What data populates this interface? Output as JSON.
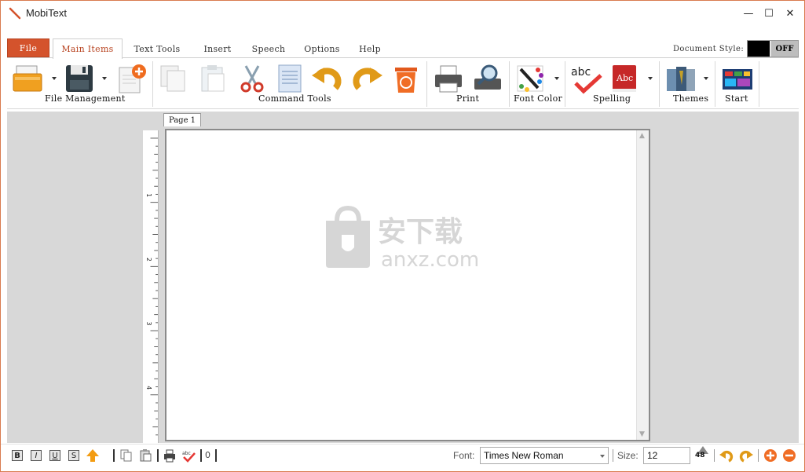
{
  "window": {
    "title": "MobiText",
    "minimize": "—",
    "maximize": "☐",
    "close": "✕"
  },
  "tabs": [
    {
      "label": "File"
    },
    {
      "label": "Main Items"
    },
    {
      "label": "Text Tools"
    },
    {
      "label": "Insert"
    },
    {
      "label": "Speech"
    },
    {
      "label": "Options"
    },
    {
      "label": "Help"
    }
  ],
  "document_style": {
    "label": "Document Style:",
    "toggle": "OFF"
  },
  "ribbon": {
    "groups": [
      {
        "label": "File Management"
      },
      {
        "label": "Command Tools"
      },
      {
        "label": "Print"
      },
      {
        "label": "Font Color"
      },
      {
        "label": "Spelling"
      },
      {
        "label": "Themes"
      },
      {
        "label": "Start"
      }
    ]
  },
  "document": {
    "page_tab": "Page 1",
    "ruler_marks": [
      "1",
      "2",
      "3",
      "4"
    ]
  },
  "watermark": {
    "text_cn": "安下载",
    "text_en": "anxz.com"
  },
  "bottombar": {
    "bold": "B",
    "italic": "I",
    "underline": "U",
    "strike": "S",
    "counter": "0",
    "font_label": "Font:",
    "font_value": "Times New Roman",
    "size_label": "Size:",
    "size_value": "12",
    "size_small": "48"
  },
  "colors": {
    "accent": "#d4532c",
    "workarea": "#d8d8d8"
  }
}
